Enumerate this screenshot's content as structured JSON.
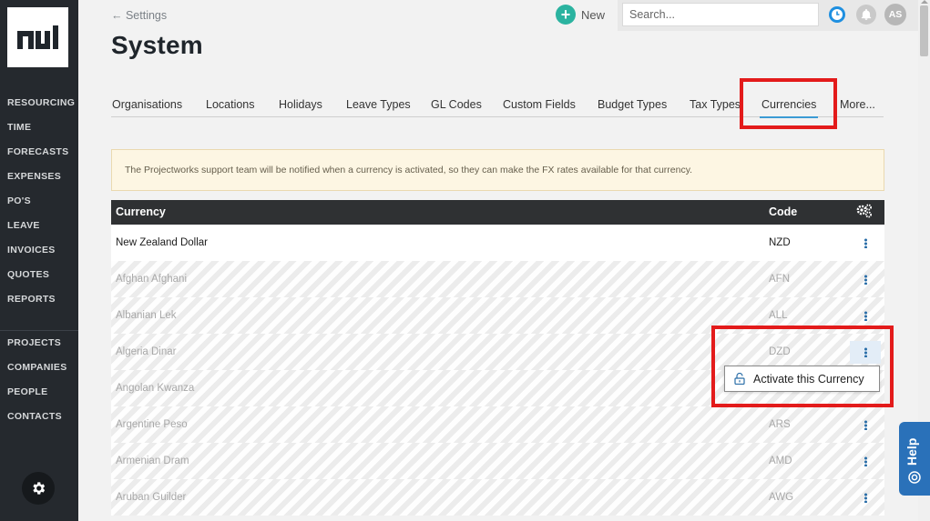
{
  "sidebar": {
    "primary": [
      "RESOURCING",
      "TIME",
      "FORECASTS",
      "EXPENSES",
      "PO'S",
      "LEAVE",
      "INVOICES",
      "QUOTES",
      "REPORTS"
    ],
    "secondary": [
      "PROJECTS",
      "COMPANIES",
      "PEOPLE",
      "CONTACTS"
    ]
  },
  "header": {
    "back_label": "← Settings",
    "title": "System",
    "new_label": "New",
    "search_placeholder": "Search...",
    "avatar_initials": "AS"
  },
  "tabs": [
    "Organisations",
    "Locations",
    "Holidays",
    "Leave Types",
    "GL Codes",
    "Custom Fields",
    "Budget Types",
    "Tax Types",
    "Currencies",
    "More..."
  ],
  "active_tab": "Currencies",
  "notice": "The Projectworks support team will be notified when a currency is activated, so they can make the FX rates available for that currency.",
  "table": {
    "col_currency": "Currency",
    "col_code": "Code",
    "rows": [
      {
        "name": "New Zealand Dollar",
        "code": "NZD",
        "active": true
      },
      {
        "name": "Afghan Afghani",
        "code": "AFN",
        "active": false
      },
      {
        "name": "Albanian Lek",
        "code": "ALL",
        "active": false
      },
      {
        "name": "Algeria Dinar",
        "code": "DZD",
        "active": false
      },
      {
        "name": "Angolan Kwanza",
        "code": "",
        "active": false
      },
      {
        "name": "Argentine Peso",
        "code": "ARS",
        "active": false
      },
      {
        "name": "Armenian Dram",
        "code": "AMD",
        "active": false
      },
      {
        "name": "Aruban Guilder",
        "code": "AWG",
        "active": false
      }
    ]
  },
  "row_menu": {
    "action_label": "Activate this Currency"
  },
  "help_label": "Help",
  "colors": {
    "sidebar": "#25292e",
    "accent": "#3b9bd4",
    "new_button": "#2bb3a0",
    "highlight": "#e31b1b",
    "help": "#2a71b9"
  }
}
